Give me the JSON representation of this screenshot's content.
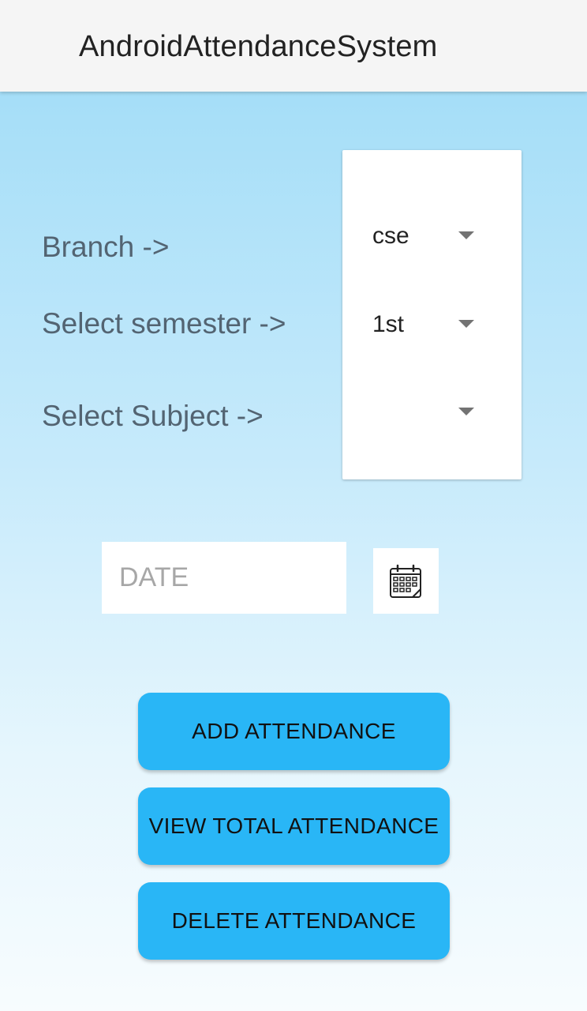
{
  "app_bar": {
    "title": "AndroidAttendanceSystem"
  },
  "form": {
    "branch_label": "Branch ->",
    "semester_label": "Select semester ->",
    "subject_label": "Select Subject ->",
    "branch_value": "cse",
    "semester_value": "1st",
    "subject_value": ""
  },
  "date": {
    "placeholder": "DATE",
    "value": "",
    "icon": "calendar-icon"
  },
  "actions": {
    "add": "ADD ATTENDANCE",
    "view": "VIEW TOTAL ATTENDANCE",
    "delete": "DELETE ATTENDANCE"
  },
  "colors": {
    "app_bar": "#f5f5f5",
    "button": "#29b6f6",
    "label_text": "#536472",
    "background_top": "#9ddbf7",
    "background_bottom": "#f7fcfe"
  }
}
